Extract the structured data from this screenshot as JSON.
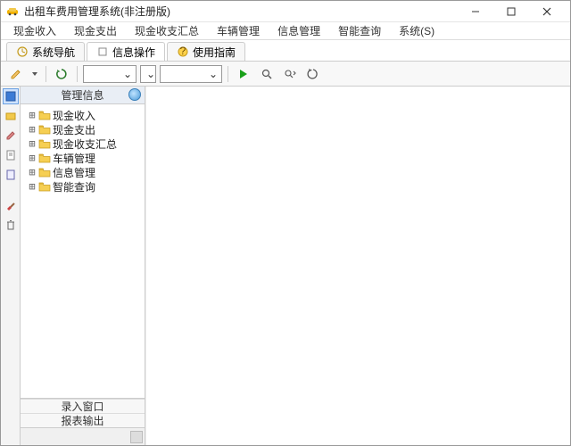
{
  "window": {
    "title": "出租车费用管理系统(非注册版)"
  },
  "menu": {
    "items": [
      "现金收入",
      "现金支出",
      "现金收支汇总",
      "车辆管理",
      "信息管理",
      "智能查询",
      "系统(S)"
    ]
  },
  "tabs": {
    "items": [
      {
        "label": "系统导航"
      },
      {
        "label": "信息操作"
      },
      {
        "label": "使用指南"
      }
    ],
    "activeIndex": 1
  },
  "toolbar": {
    "combo1_width": 60,
    "combo2_width": 18,
    "combo3_width": 70
  },
  "tree": {
    "header": "管理信息",
    "items": [
      {
        "label": "现金收入"
      },
      {
        "label": "现金支出"
      },
      {
        "label": "现金收支汇总"
      },
      {
        "label": "车辆管理"
      },
      {
        "label": "信息管理"
      },
      {
        "label": "智能查询"
      }
    ]
  },
  "stack": {
    "items": [
      "录入窗口",
      "报表输出"
    ]
  }
}
